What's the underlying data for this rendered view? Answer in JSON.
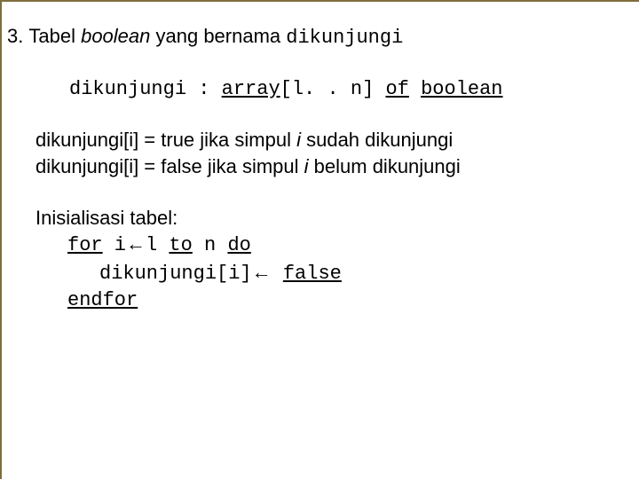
{
  "slide": {
    "item_number": "3.",
    "heading_prefix": "Tabel ",
    "heading_italic": "boolean",
    "heading_mid": " yang bernama ",
    "heading_code": "dikunjungi",
    "decl_lhs": "dikunjungi : ",
    "decl_kw_array": "array",
    "decl_bracket": "[l. . n] ",
    "decl_kw_of": "of",
    "decl_space": " ",
    "decl_kw_boolean": "boolean",
    "line_true_a": "dikunjungi[i] = true jika simpul ",
    "line_true_i": "i",
    "line_true_b": " sudah dikunjungi",
    "line_false_a": "dikunjungi[i] = false jika simpul ",
    "line_false_i": "i",
    "line_false_b": " belum dikunjungi",
    "init_label": "Inisialisasi tabel:",
    "kw_for": "for",
    "for_mid_a": " i",
    "for_arrow": "←",
    "for_mid_b": "l ",
    "kw_to": "to",
    "for_mid_c": " n ",
    "kw_do": "do",
    "assign_lhs": "dikunjungi[i]",
    "assign_arrow": "←",
    "assign_space": " ",
    "kw_false": "false",
    "kw_endfor": "endfor"
  }
}
